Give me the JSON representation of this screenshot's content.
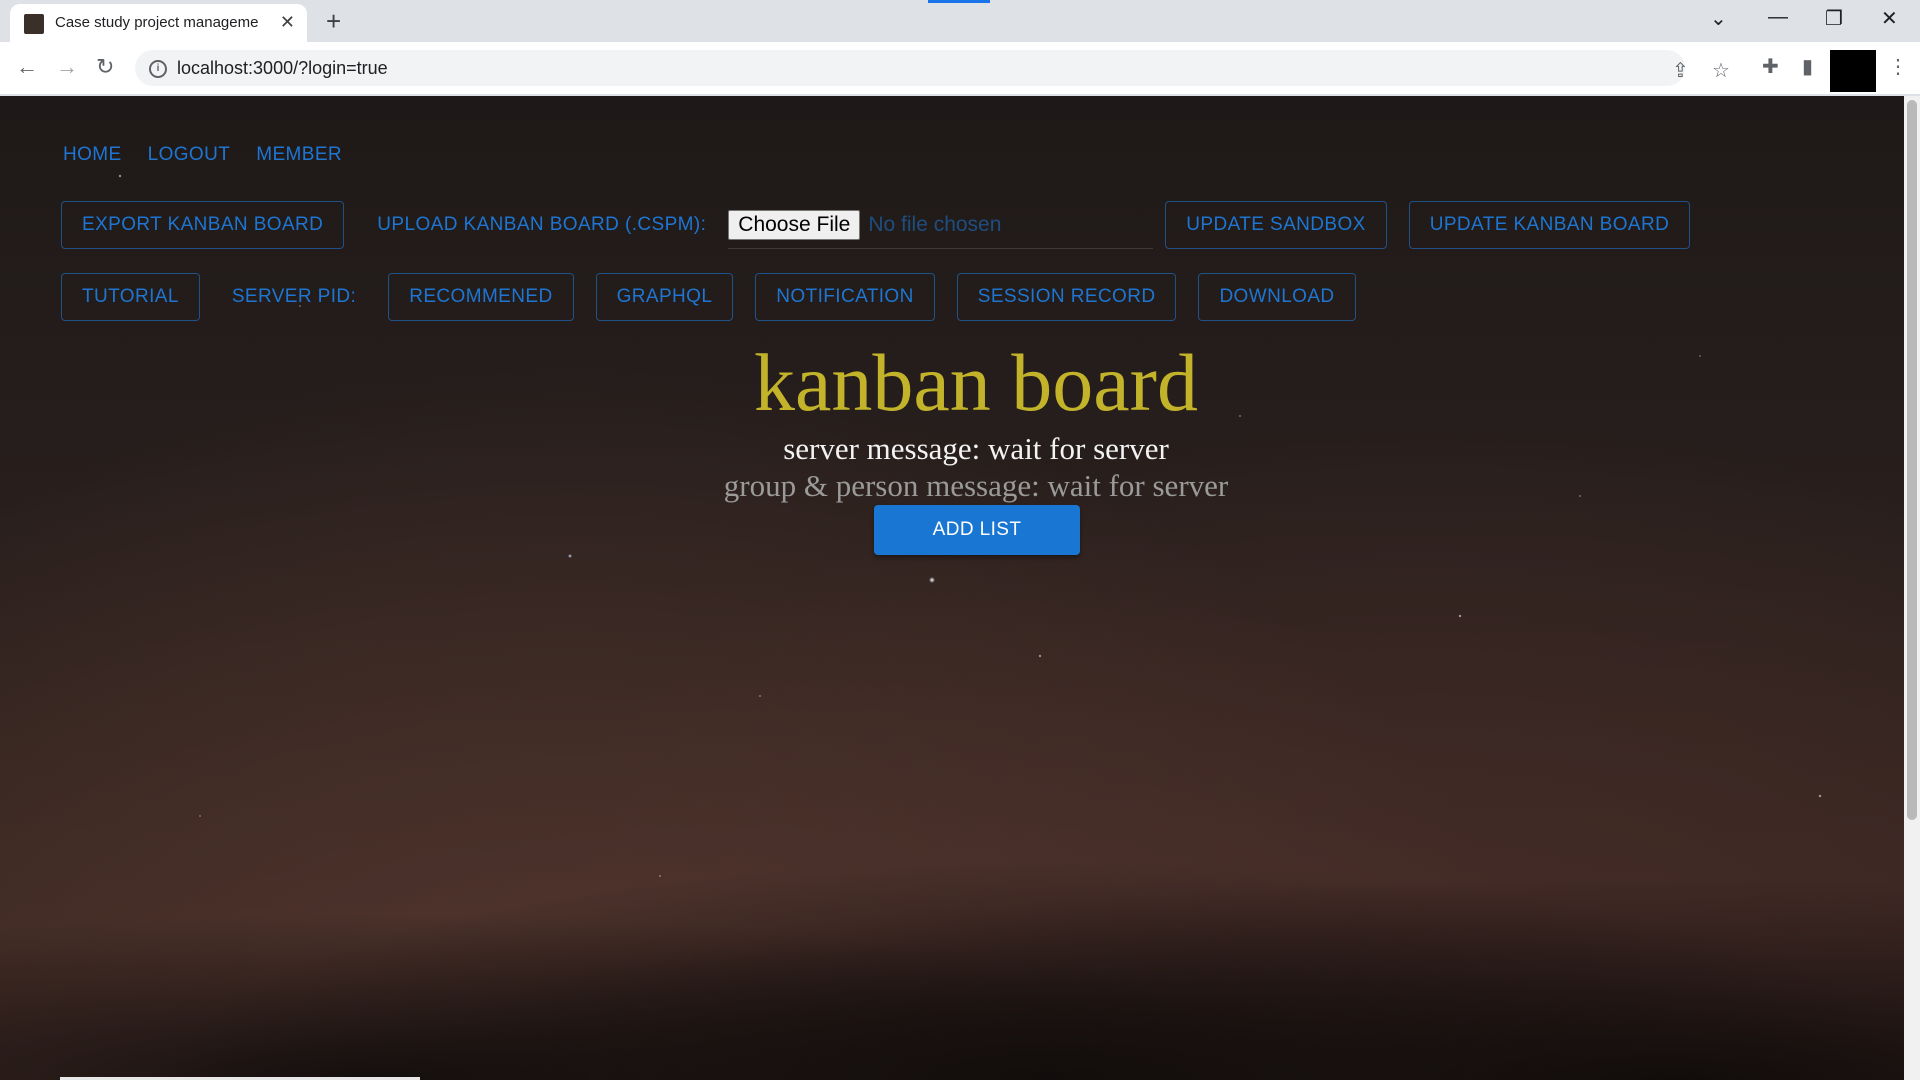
{
  "browser": {
    "tab_title": "Case study project manageme",
    "new_tab": "+",
    "tab_close": "✕",
    "url": "localhost:3000/?login=true",
    "window_minimize": "—",
    "window_restore": "❐",
    "window_close": "✕",
    "tab_list": "⌄"
  },
  "nav": {
    "home": "HOME",
    "logout": "LOGOUT",
    "member": "MEMBER"
  },
  "toolbar_row1": {
    "export": "EXPORT KANBAN BOARD",
    "upload_label": "UPLOAD KANBAN BOARD (.CSPM):",
    "choose_file": "Choose File",
    "file_status": "No file chosen",
    "update_sandbox": "UPDATE SANDBOX",
    "update_kanban": "UPDATE KANBAN BOARD"
  },
  "toolbar_row2": {
    "tutorial": "TUTORIAL",
    "server_pid": "SERVER PID:",
    "recommened": "RECOMMENED",
    "graphql": "GRAPHQL",
    "notification": "NOTIFICATION",
    "session_record": "SESSION RECORD",
    "download": "DOWNLOAD"
  },
  "board": {
    "title": "kanban board",
    "server_message": "server message: wait for server",
    "group_message": "group & person message: wait for server",
    "add_list": "ADD LIST"
  },
  "colors": {
    "link_blue": "#1e76d2",
    "title_gold": "#c2b32a",
    "primary_button": "#1976d2"
  }
}
